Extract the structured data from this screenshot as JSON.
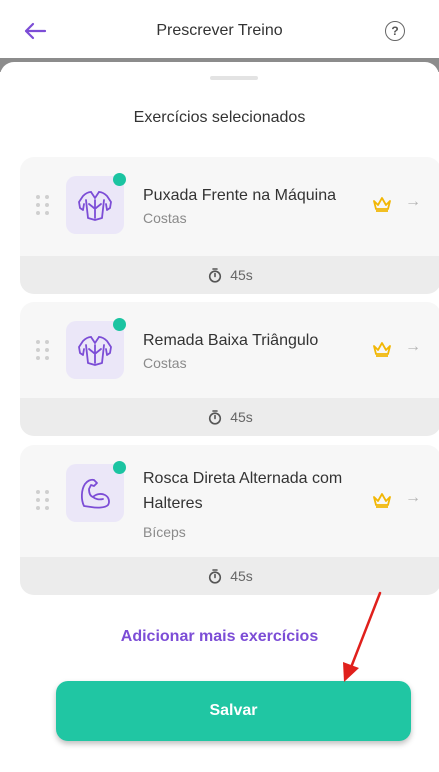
{
  "header": {
    "title": "Prescrever Treino",
    "back_icon": "arrow-left-icon",
    "help_icon": "help-circle-icon",
    "help_glyph": "?"
  },
  "sheet": {
    "title": "Exercícios selecionados"
  },
  "exercises": [
    {
      "name": "Puxada Frente na Máquina",
      "category": "Costas",
      "duration": "45s",
      "icon": "back-muscle-icon",
      "arrow": "→"
    },
    {
      "name": "Remada Baixa Triângulo",
      "category": "Costas",
      "duration": "45s",
      "icon": "back-muscle-icon",
      "arrow": "→"
    },
    {
      "name": "Rosca Direta Alternada com Halteres",
      "category": "Bíceps",
      "duration": "45s",
      "icon": "biceps-icon",
      "arrow": "→"
    }
  ],
  "actions": {
    "add_more": "Adicionar mais exercícios",
    "save": "Salvar"
  },
  "colors": {
    "accent_purple": "#7c4dd6",
    "primary_green": "#20c6a3",
    "status_dot": "#1bc4a1",
    "crown": "#f2b705",
    "annotation_arrow": "#e0201c"
  }
}
